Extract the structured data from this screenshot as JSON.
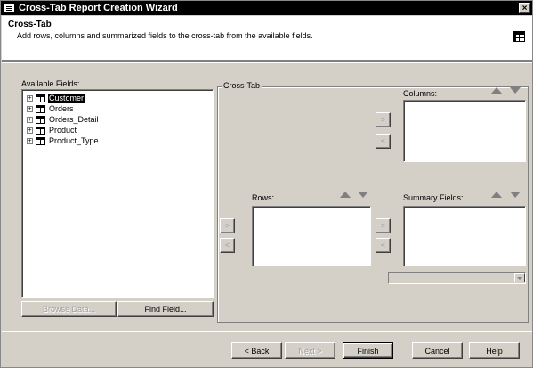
{
  "window": {
    "title": "Cross-Tab Report Creation Wizard",
    "close_glyph": "×"
  },
  "header": {
    "title": "Cross-Tab",
    "subtitle": "Add rows, columns and summarized fields to the cross-tab from the available fields."
  },
  "available_fields": {
    "label": "Available Fields:",
    "items": [
      {
        "label": "Customer",
        "selected": true
      },
      {
        "label": "Orders",
        "selected": false
      },
      {
        "label": "Orders_Detail",
        "selected": false
      },
      {
        "label": "Product",
        "selected": false
      },
      {
        "label": "Product_Type",
        "selected": false
      }
    ],
    "expand_glyph": "+",
    "browse_data_label": "Browse Data...",
    "find_field_label": "Find Field..."
  },
  "crosstab": {
    "group_label": "Cross-Tab",
    "columns_label": "Columns:",
    "rows_label": "Rows:",
    "summary_label": "Summary Fields:",
    "add_glyph": ">",
    "remove_glyph": "<"
  },
  "footer": {
    "back_label": "< Back",
    "next_label": "Next >",
    "finish_label": "Finish",
    "cancel_label": "Cancel",
    "help_label": "Help"
  }
}
